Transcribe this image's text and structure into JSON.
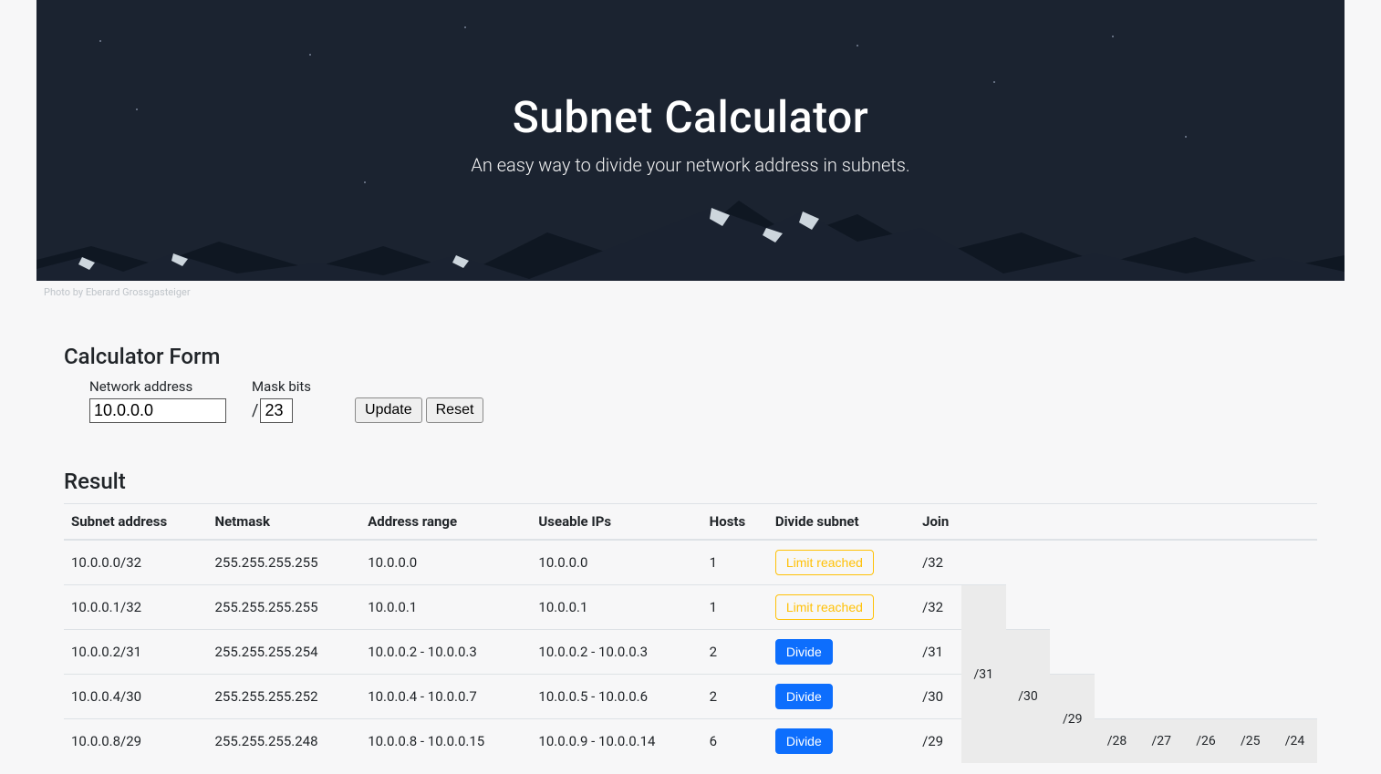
{
  "hero": {
    "title": "Subnet Calculator",
    "subtitle": "An easy way to divide your network address in subnets.",
    "photo_credit": "Photo by Eberard Grossgasteiger"
  },
  "form": {
    "heading": "Calculator Form",
    "network_label": "Network address",
    "network_value": "10.0.0.0",
    "mask_label": "Mask bits",
    "mask_value": "23",
    "slash": "/",
    "update_btn": "Update",
    "reset_btn": "Reset"
  },
  "result": {
    "heading": "Result",
    "columns": {
      "subnet": "Subnet address",
      "netmask": "Netmask",
      "range": "Address range",
      "useable": "Useable IPs",
      "hosts": "Hosts",
      "divide": "Divide subnet",
      "join": "Join"
    },
    "rows": [
      {
        "subnet": "10.0.0.0/32",
        "netmask": "255.255.255.255",
        "range": "10.0.0.0",
        "useable": "10.0.0.0",
        "hosts": "1",
        "divide_state": "limit",
        "join_label": "/32"
      },
      {
        "subnet": "10.0.0.1/32",
        "netmask": "255.255.255.255",
        "range": "10.0.0.1",
        "useable": "10.0.0.1",
        "hosts": "1",
        "divide_state": "limit",
        "join_label": "/32"
      },
      {
        "subnet": "10.0.0.2/31",
        "netmask": "255.255.255.254",
        "range": "10.0.0.2 - 10.0.0.3",
        "useable": "10.0.0.2 - 10.0.0.3",
        "hosts": "2",
        "divide_state": "divide",
        "join_label": "/31"
      },
      {
        "subnet": "10.0.0.4/30",
        "netmask": "255.255.255.252",
        "range": "10.0.0.4 - 10.0.0.7",
        "useable": "10.0.0.5 - 10.0.0.6",
        "hosts": "2",
        "divide_state": "divide",
        "join_label": "/30"
      },
      {
        "subnet": "10.0.0.8/29",
        "netmask": "255.255.255.248",
        "range": "10.0.0.8 - 10.0.0.15",
        "useable": "10.0.0.9 - 10.0.0.14",
        "hosts": "6",
        "divide_state": "divide",
        "join_label": "/29"
      }
    ],
    "divide_label": "Divide",
    "limit_label": "Limit reached",
    "join_levels": [
      "/31",
      "/30",
      "/29",
      "/28",
      "/27",
      "/26",
      "/25",
      "/24"
    ]
  }
}
